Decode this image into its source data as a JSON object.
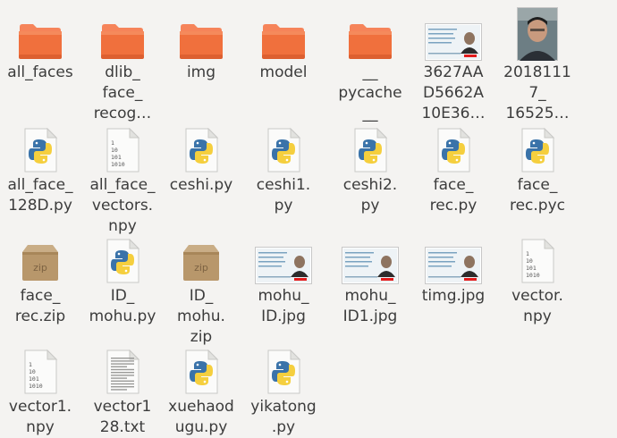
{
  "colors": {
    "folder_top": "#f6845a",
    "folder_body": "#f0703d",
    "background": "#f4f3f1",
    "text": "#3c3c3c"
  },
  "files": [
    {
      "label": "all_faces",
      "icon": "folder-icon"
    },
    {
      "label": "dlib_\nface_\nrecog…",
      "icon": "folder-icon"
    },
    {
      "label": "img",
      "icon": "folder-icon"
    },
    {
      "label": "model",
      "icon": "folder-icon"
    },
    {
      "label": "__\npycache\n__",
      "icon": "folder-icon"
    },
    {
      "label": "3627AA\nD5662A\n10E36…",
      "icon": "id-card-thumbnail-icon"
    },
    {
      "label": "2018111\n7_\n16525…",
      "icon": "face-photo-thumbnail-icon"
    },
    {
      "label": "all_face_\n128D.py",
      "icon": "python-file-icon"
    },
    {
      "label": "all_face_\nvectors.\nnpy",
      "icon": "binary-file-icon"
    },
    {
      "label": "ceshi.py",
      "icon": "python-file-icon"
    },
    {
      "label": "ceshi1.\npy",
      "icon": "python-file-icon"
    },
    {
      "label": "ceshi2.\npy",
      "icon": "python-file-icon"
    },
    {
      "label": "face_\nrec.py",
      "icon": "python-file-icon"
    },
    {
      "label": "face_\nrec.pyc",
      "icon": "python-file-icon"
    },
    {
      "label": "face_\nrec.zip",
      "icon": "zip-archive-icon"
    },
    {
      "label": "ID_\nmohu.py",
      "icon": "python-file-icon"
    },
    {
      "label": "ID_\nmohu.\nzip",
      "icon": "zip-archive-icon"
    },
    {
      "label": "mohu_\nID.jpg",
      "icon": "id-card-thumbnail-icon"
    },
    {
      "label": "mohu_\nID1.jpg",
      "icon": "id-card-thumbnail-icon"
    },
    {
      "label": "timg.jpg",
      "icon": "id-card-thumbnail-icon"
    },
    {
      "label": "vector.\nnpy",
      "icon": "binary-file-icon"
    },
    {
      "label": "vector1.\nnpy",
      "icon": "binary-file-icon"
    },
    {
      "label": "vector1\n28.txt",
      "icon": "text-file-icon"
    },
    {
      "label": "xuehaod\nugu.py",
      "icon": "python-file-icon"
    },
    {
      "label": "yikatong\n.py",
      "icon": "python-file-icon"
    }
  ]
}
